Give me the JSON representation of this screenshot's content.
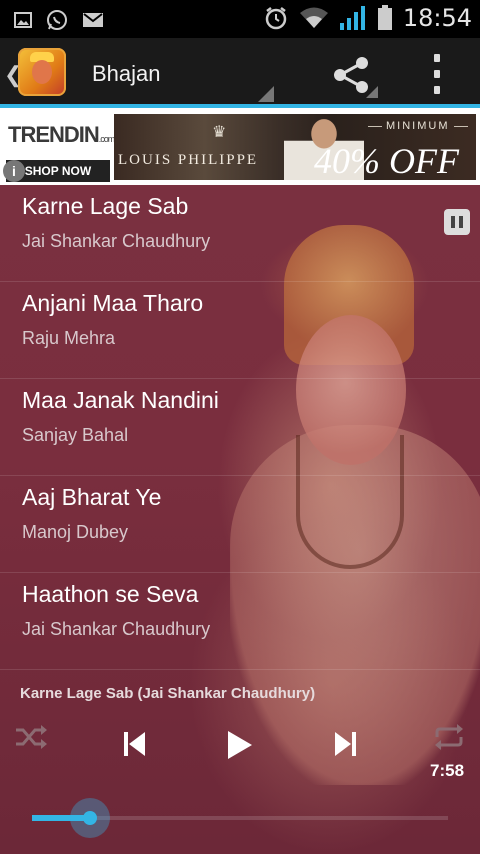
{
  "status_bar": {
    "left_icons": [
      "picture-icon",
      "whatsapp-icon",
      "gmail-icon"
    ],
    "right_icons": [
      "alarm-icon",
      "wifi-icon",
      "signal-icon",
      "battery-icon"
    ],
    "time": "18:54"
  },
  "action_bar": {
    "title": "Bhajan",
    "accent_color": "#33b5e5",
    "icons": [
      "back-chevron-icon",
      "app-icon",
      "share-icon",
      "overflow-menu-icon"
    ]
  },
  "ad": {
    "brand1": "TRENDIN",
    "brand1_suffix": ".com",
    "cta": "SHOP NOW",
    "brand2": "LOUIS PHILIPPE",
    "offer_prefix": "MINIMUM",
    "offer": "40% OFF",
    "info": "i"
  },
  "tracks": [
    {
      "title": "Karne Lage Sab",
      "artist": "Jai Shankar Chaudhury",
      "playing": true
    },
    {
      "title": "Anjani Maa Tharo",
      "artist": "Raju Mehra"
    },
    {
      "title": "Maa Janak Nandini",
      "artist": "Sanjay Bahal"
    },
    {
      "title": "Aaj Bharat Ye",
      "artist": "Manoj Dubey"
    },
    {
      "title": "Haathon se Seva",
      "artist": "Jai Shankar Chaudhury"
    }
  ],
  "player": {
    "now_playing": "Karne Lage Sab (Jai Shankar Chaudhury)",
    "duration": "7:58",
    "progress_fraction": 0.14
  }
}
